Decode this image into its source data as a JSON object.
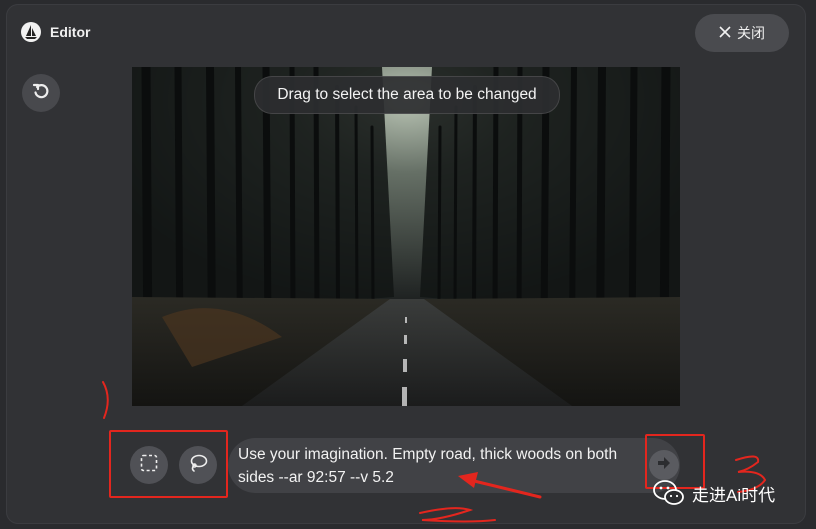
{
  "window": {
    "title": "Editor",
    "close_label": "关闭"
  },
  "canvas": {
    "hint": "Drag to select the area to be changed"
  },
  "prompt": {
    "text": "Use your imagination. Empty road, thick woods on both sides --ar 92:57 --v 5.2"
  },
  "icons": {
    "logo": "sailboat-logo-icon",
    "close": "close-icon",
    "undo": "undo-icon",
    "rect_select": "rectangle-select-icon",
    "lasso": "lasso-select-icon",
    "send": "arrow-right-icon"
  },
  "watermark": {
    "text": "走进Ai时代"
  },
  "colors": {
    "background": "#313235",
    "annotation": "#e3261e"
  }
}
